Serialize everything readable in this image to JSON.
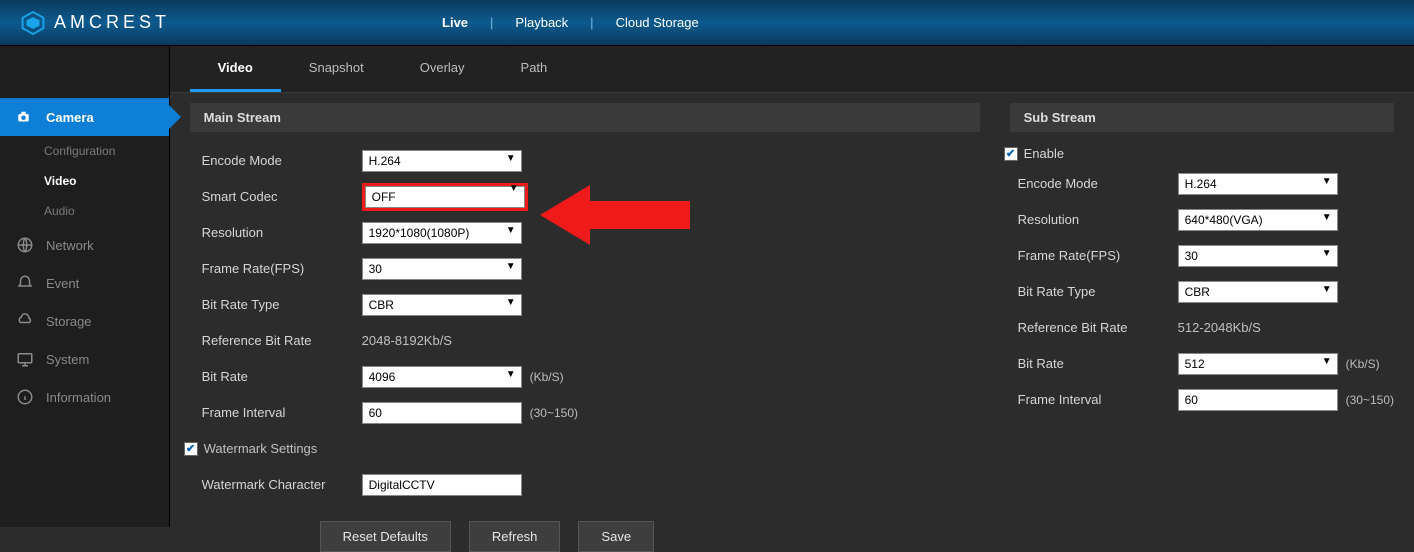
{
  "brand": "AMCREST",
  "top_nav": {
    "live": "Live",
    "playback": "Playback",
    "cloud": "Cloud Storage"
  },
  "sidebar": {
    "camera": "Camera",
    "sub": {
      "config": "Configuration",
      "video": "Video",
      "audio": "Audio"
    },
    "network": "Network",
    "event": "Event",
    "storage": "Storage",
    "system": "System",
    "information": "Information"
  },
  "tabs": {
    "video": "Video",
    "snapshot": "Snapshot",
    "overlay": "Overlay",
    "path": "Path"
  },
  "main": {
    "title": "Main Stream",
    "encode_mode_label": "Encode Mode",
    "encode_mode": "H.264",
    "smart_codec_label": "Smart Codec",
    "smart_codec": "OFF",
    "resolution_label": "Resolution",
    "resolution": "1920*1080(1080P)",
    "fps_label": "Frame Rate(FPS)",
    "fps": "30",
    "bitrate_type_label": "Bit Rate Type",
    "bitrate_type": "CBR",
    "ref_bitrate_label": "Reference Bit Rate",
    "ref_bitrate": "2048-8192Kb/S",
    "bitrate_label": "Bit Rate",
    "bitrate": "4096",
    "bitrate_unit": "(Kb/S)",
    "frame_interval_label": "Frame Interval",
    "frame_interval": "60",
    "frame_interval_range": "(30~150)",
    "watermark_settings": "Watermark Settings",
    "watermark_char_label": "Watermark Character",
    "watermark_char": "DigitalCCTV"
  },
  "sub": {
    "title": "Sub Stream",
    "enable": "Enable",
    "encode_mode_label": "Encode Mode",
    "encode_mode": "H.264",
    "resolution_label": "Resolution",
    "resolution": "640*480(VGA)",
    "fps_label": "Frame Rate(FPS)",
    "fps": "30",
    "bitrate_type_label": "Bit Rate Type",
    "bitrate_type": "CBR",
    "ref_bitrate_label": "Reference Bit Rate",
    "ref_bitrate": "512-2048Kb/S",
    "bitrate_label": "Bit Rate",
    "bitrate": "512",
    "bitrate_unit": "(Kb/S)",
    "frame_interval_label": "Frame Interval",
    "frame_interval": "60",
    "frame_interval_range": "(30~150)"
  },
  "buttons": {
    "reset": "Reset Defaults",
    "refresh": "Refresh",
    "save": "Save"
  }
}
